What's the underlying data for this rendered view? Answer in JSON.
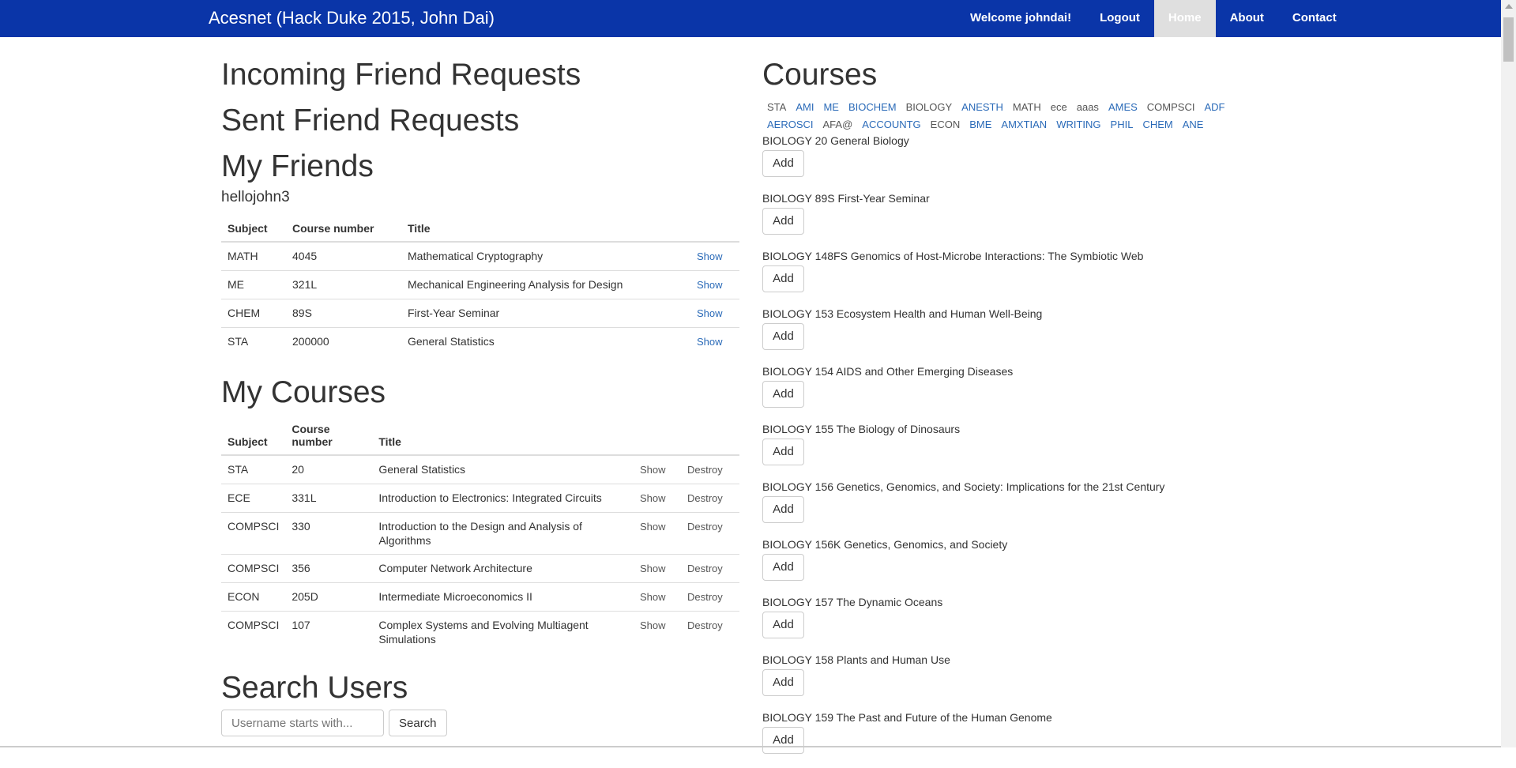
{
  "nav": {
    "brand": "Acesnet (Hack Duke 2015, John Dai)",
    "welcome": "Welcome johndai!",
    "logout": "Logout",
    "home": "Home",
    "about": "About",
    "contact": "Contact"
  },
  "left": {
    "incoming_title": "Incoming Friend Requests",
    "sent_title": "Sent Friend Requests",
    "friends_title": "My Friends",
    "friend_name": "hellojohn3",
    "friends_headers": {
      "subject": "Subject",
      "number": "Course number",
      "title": "Title"
    },
    "friend_courses": [
      {
        "subject": "MATH",
        "number": "4045",
        "title": "Mathematical Cryptography",
        "show": "Show"
      },
      {
        "subject": "ME",
        "number": "321L",
        "title": "Mechanical Engineering Analysis for Design",
        "show": "Show"
      },
      {
        "subject": "CHEM",
        "number": "89S",
        "title": "First-Year Seminar",
        "show": "Show"
      },
      {
        "subject": "STA",
        "number": "200000",
        "title": "General Statistics",
        "show": "Show"
      }
    ],
    "courses_title": "My Courses",
    "courses_headers": {
      "subject": "Subject",
      "number": "Course number",
      "title": "Title"
    },
    "my_courses": [
      {
        "subject": "STA",
        "number": "20",
        "title": "General Statistics",
        "show": "Show",
        "destroy": "Destroy"
      },
      {
        "subject": "ECE",
        "number": "331L",
        "title": "Introduction to Electronics: Integrated Circuits",
        "show": "Show",
        "destroy": "Destroy"
      },
      {
        "subject": "COMPSCI",
        "number": "330",
        "title": "Introduction to the Design and Analysis of Algorithms",
        "show": "Show",
        "destroy": "Destroy"
      },
      {
        "subject": "COMPSCI",
        "number": "356",
        "title": "Computer Network Architecture",
        "show": "Show",
        "destroy": "Destroy"
      },
      {
        "subject": "ECON",
        "number": "205D",
        "title": "Intermediate Microeconomics II",
        "show": "Show",
        "destroy": "Destroy"
      },
      {
        "subject": "COMPSCI",
        "number": "107",
        "title": "Complex Systems and Evolving Multiagent Simulations",
        "show": "Show",
        "destroy": "Destroy"
      }
    ],
    "search_title": "Search Users",
    "search_placeholder": "Username starts with...",
    "search_button": "Search"
  },
  "right": {
    "title": "Courses",
    "subjects": [
      {
        "label": "STA",
        "link": false
      },
      {
        "label": "AMI",
        "link": true
      },
      {
        "label": "ME",
        "link": true
      },
      {
        "label": "BIOCHEM",
        "link": true
      },
      {
        "label": "BIOLOGY",
        "link": false
      },
      {
        "label": "ANESTH",
        "link": true
      },
      {
        "label": "MATH",
        "link": false
      },
      {
        "label": "ece",
        "link": false
      },
      {
        "label": "aaas",
        "link": false
      },
      {
        "label": "AMES",
        "link": true
      },
      {
        "label": "COMPSCI",
        "link": false
      },
      {
        "label": "ADF",
        "link": true
      },
      {
        "label": "AEROSCI",
        "link": true
      },
      {
        "label": "AFA@",
        "link": false
      },
      {
        "label": "ACCOUNTG",
        "link": true
      },
      {
        "label": "ECON",
        "link": false
      },
      {
        "label": "BME",
        "link": true
      },
      {
        "label": "AMXTIAN",
        "link": true
      },
      {
        "label": "WRITING",
        "link": true
      },
      {
        "label": "PHIL",
        "link": true
      },
      {
        "label": "CHEM",
        "link": true
      },
      {
        "label": "ANE",
        "link": true
      }
    ],
    "courses": [
      {
        "title": "BIOLOGY 20 General Biology",
        "button": "Add"
      },
      {
        "title": "BIOLOGY 89S First-Year Seminar",
        "button": "Add"
      },
      {
        "title": "BIOLOGY 148FS Genomics of Host-Microbe Interactions: The Symbiotic Web",
        "button": "Add"
      },
      {
        "title": "BIOLOGY 153 Ecosystem Health and Human Well-Being",
        "button": "Add"
      },
      {
        "title": "BIOLOGY 154 AIDS and Other Emerging Diseases",
        "button": "Add"
      },
      {
        "title": "BIOLOGY 155 The Biology of Dinosaurs",
        "button": "Add"
      },
      {
        "title": "BIOLOGY 156 Genetics, Genomics, and Society: Implications for the 21st Century",
        "button": "Add"
      },
      {
        "title": "BIOLOGY 156K Genetics, Genomics, and Society",
        "button": "Add"
      },
      {
        "title": "BIOLOGY 157 The Dynamic Oceans",
        "button": "Add"
      },
      {
        "title": "BIOLOGY 158 Plants and Human Use",
        "button": "Add"
      },
      {
        "title": "BIOLOGY 159 The Past and Future of the Human Genome",
        "button": "Add"
      }
    ]
  },
  "colors": {
    "navbar": "#0a35a8",
    "link": "#2a6ab8",
    "active_tab": "#dfdfdf"
  }
}
